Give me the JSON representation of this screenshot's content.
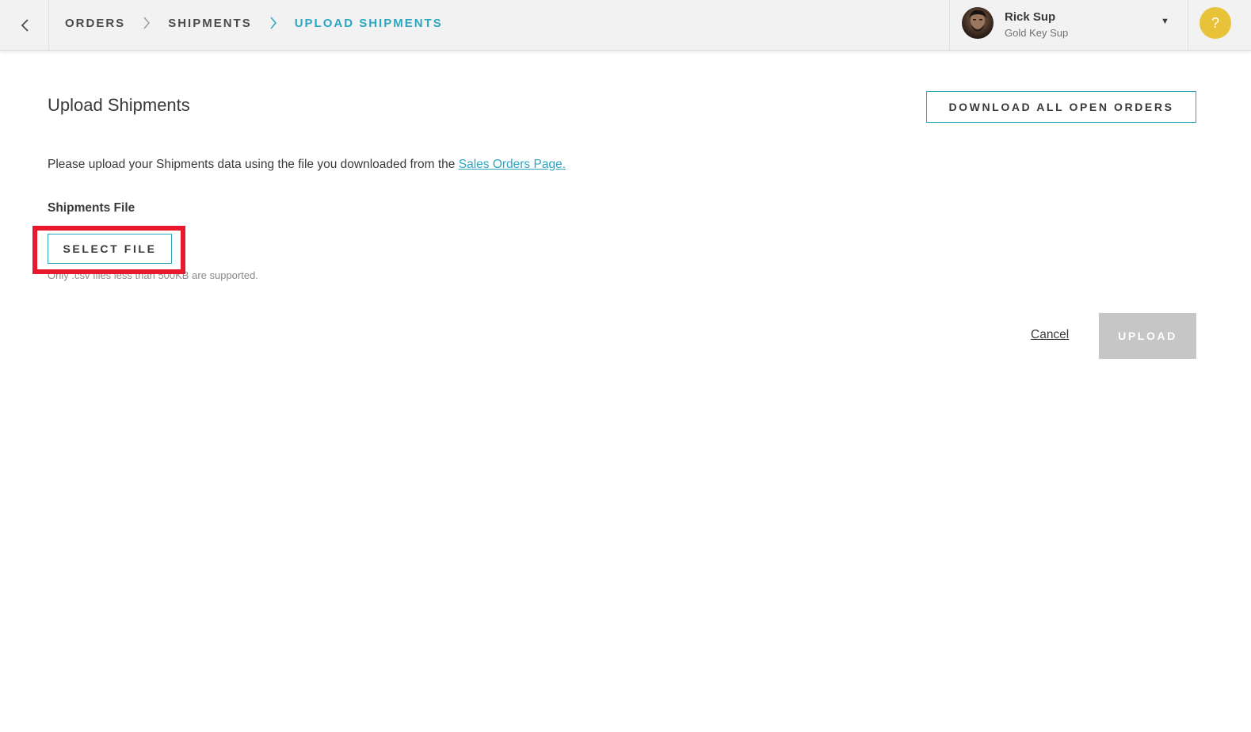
{
  "breadcrumb": {
    "items": [
      {
        "label": "ORDERS"
      },
      {
        "label": "SHIPMENTS"
      },
      {
        "label": "UPLOAD SHIPMENTS"
      }
    ]
  },
  "user": {
    "name": "Rick Sup",
    "role": "Gold Key Sup",
    "caret": "▼"
  },
  "help": {
    "label": "?"
  },
  "page": {
    "title": "Upload Shipments",
    "download_button": "DOWNLOAD ALL OPEN ORDERS",
    "intro_text": "Please upload your Shipments data using the file you downloaded from the ",
    "intro_link": "Sales Orders Page.",
    "field_label": "Shipments File",
    "select_file_button": "SELECT FILE",
    "hint": "Only .csv files less than 500KB are supported.",
    "cancel": "Cancel",
    "upload_button": "UPLOAD"
  },
  "colors": {
    "accent": "#2aa7c1",
    "highlight": "#e8192c",
    "help": "#e8c33a",
    "disabled": "#c6c6c6"
  }
}
